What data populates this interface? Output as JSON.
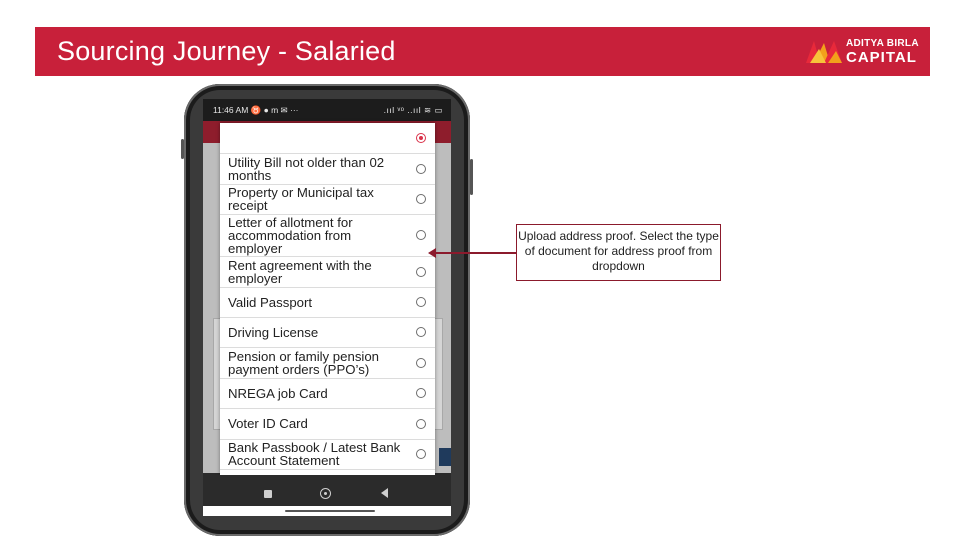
{
  "slide": {
    "title": "Sourcing Journey - Salaried",
    "brand": {
      "line1": "ADITYA BIRLA",
      "line2": "CAPITAL",
      "colors": {
        "banner": "#c8203a",
        "logo_red": "#e8293a",
        "logo_orange": "#f2a11b"
      }
    }
  },
  "phone": {
    "status_bar": {
      "time": "11:46 AM ♉ ● m ✉ ···",
      "right": ".ııl ᵛᵒ ..ııl ≋ ▭"
    },
    "dialog": {
      "options": [
        {
          "label": "",
          "selected": true
        },
        {
          "label": "Utility Bill not older than 02 months",
          "selected": false
        },
        {
          "label": "Property or Municipal tax receipt",
          "selected": false
        },
        {
          "label": "Letter of allotment for accommodation from employer",
          "selected": false
        },
        {
          "label": "Rent agreement with the employer",
          "selected": false
        },
        {
          "label": "Valid Passport",
          "selected": false
        },
        {
          "label": "Driving License",
          "selected": false
        },
        {
          "label": "Pension or family pension payment orders (PPO’s)",
          "selected": false
        },
        {
          "label": "NREGA job Card",
          "selected": false
        },
        {
          "label": "Voter ID Card",
          "selected": false
        },
        {
          "label": "Bank Passbook / Latest Bank Account Statement",
          "selected": false
        }
      ]
    },
    "nav_bar": {
      "icons": [
        "recent-apps-icon",
        "home-icon",
        "back-icon"
      ]
    }
  },
  "callout": {
    "text": "Upload address proof. Select the type of document for address proof from dropdown",
    "color": "#8b1a2c"
  }
}
